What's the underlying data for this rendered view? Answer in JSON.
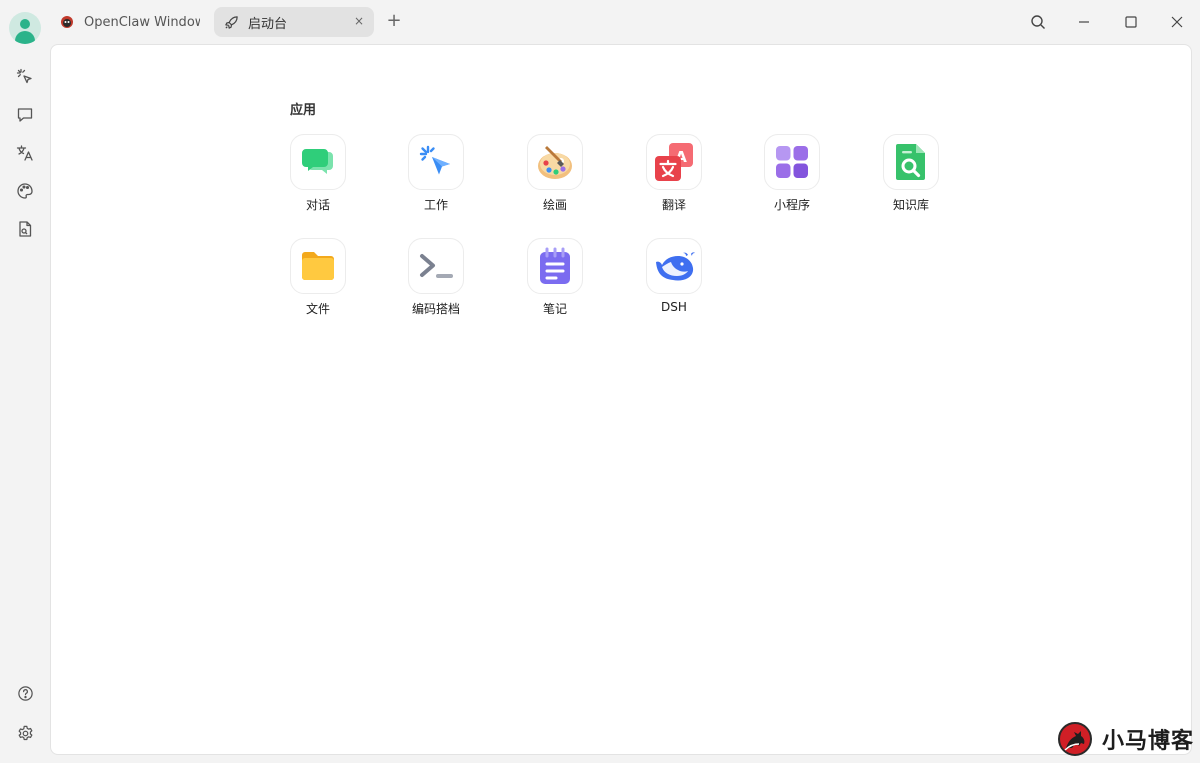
{
  "tabs": [
    {
      "label": "OpenClaw Windows",
      "icon": "openclaw-logo-icon",
      "active": false
    },
    {
      "label": "启动台",
      "icon": "rocket-icon",
      "active": true
    }
  ],
  "tab_close_glyph": "×",
  "new_tab_glyph": "+",
  "main": {
    "section_title": "应用",
    "apps": [
      {
        "label": "对话",
        "icon": "chat-icon"
      },
      {
        "label": "工作",
        "icon": "cursor-click-icon"
      },
      {
        "label": "绘画",
        "icon": "palette-icon"
      },
      {
        "label": "翻译",
        "icon": "translate-icon"
      },
      {
        "label": "小程序",
        "icon": "grid-apps-icon"
      },
      {
        "label": "知识库",
        "icon": "knowledge-doc-icon"
      },
      {
        "label": "文件",
        "icon": "folder-icon"
      },
      {
        "label": "编码搭档",
        "icon": "terminal-icon"
      },
      {
        "label": "笔记",
        "icon": "notepad-icon"
      },
      {
        "label": "DSH",
        "icon": "whale-icon"
      }
    ]
  },
  "sidebar": [
    {
      "icon": "cursor-click-icon"
    },
    {
      "icon": "chat-bubble-icon"
    },
    {
      "icon": "translate-icon"
    },
    {
      "icon": "palette-icon"
    },
    {
      "icon": "file-search-icon"
    },
    {
      "icon": "help-circle-icon"
    },
    {
      "icon": "settings-gear-icon"
    }
  ],
  "watermark": {
    "text": "小马博客"
  },
  "colors": {
    "chat": "#2fce7a",
    "work": "#3a8df5",
    "translate": "#e8424b",
    "grid": "#9b6ee8",
    "knowledge": "#37c26b",
    "folder": "#ffc22e",
    "terminal": "#6b7280",
    "notepad": "#7b6cf0",
    "whale": "#3f6ff0"
  }
}
